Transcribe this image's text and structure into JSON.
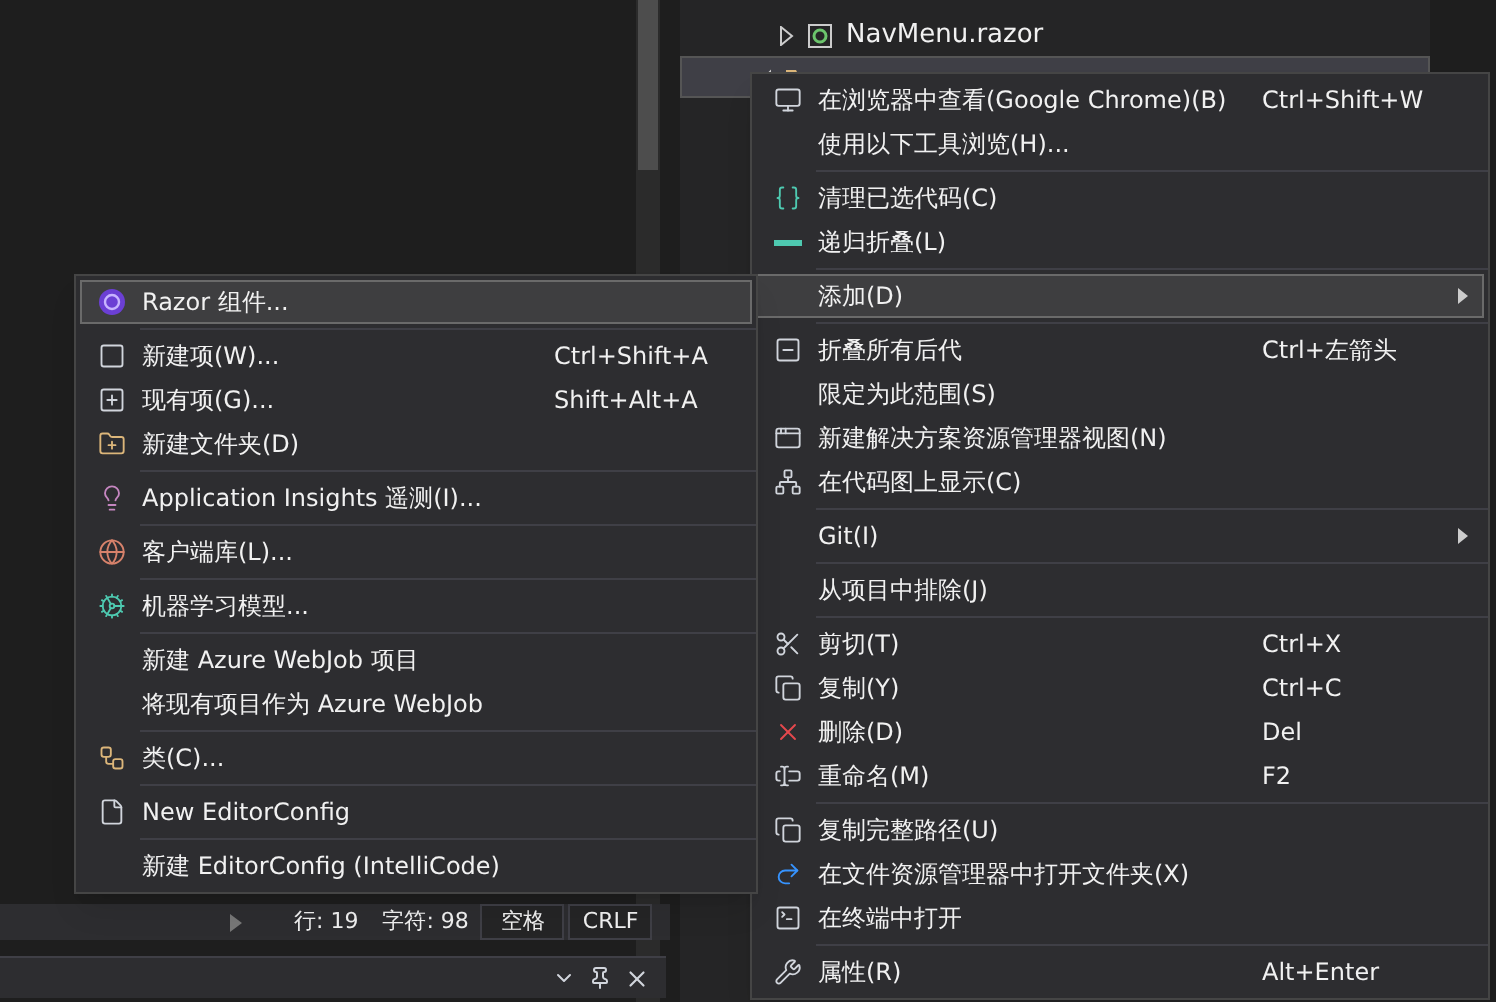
{
  "solution_explorer": {
    "rows": [
      {
        "label": "NavMenu.razor",
        "selected": false
      },
      {
        "selected": true
      }
    ]
  },
  "context_menu": {
    "groups": [
      [
        {
          "label": "在浏览器中查看(Google Chrome)(B)",
          "shortcut": "Ctrl+Shift+W",
          "selected": false,
          "submenu": false
        },
        {
          "label": "使用以下工具浏览(H)...",
          "selected": false,
          "submenu": false
        }
      ],
      [
        {
          "label": "清理已选代码(C)",
          "selected": false,
          "submenu": false
        },
        {
          "label": "递归折叠(L)",
          "selected": false,
          "submenu": false
        }
      ],
      [
        {
          "label": "添加(D)",
          "selected": true,
          "submenu": true
        }
      ],
      [
        {
          "label": "折叠所有后代",
          "shortcut": "Ctrl+左箭头",
          "selected": false,
          "submenu": false
        },
        {
          "label": "限定为此范围(S)",
          "selected": false,
          "submenu": false
        },
        {
          "label": "新建解决方案资源管理器视图(N)",
          "selected": false,
          "submenu": false
        },
        {
          "label": "在代码图上显示(C)",
          "selected": false,
          "submenu": false
        }
      ],
      [
        {
          "label": "Git(I)",
          "selected": false,
          "submenu": true
        }
      ],
      [
        {
          "label": "从项目中排除(J)",
          "selected": false,
          "submenu": false
        }
      ],
      [
        {
          "label": "剪切(T)",
          "shortcut": "Ctrl+X",
          "selected": false,
          "submenu": false
        },
        {
          "label": "复制(Y)",
          "shortcut": "Ctrl+C",
          "selected": false,
          "submenu": false
        },
        {
          "label": "删除(D)",
          "shortcut": "Del",
          "selected": false,
          "submenu": false
        },
        {
          "label": "重命名(M)",
          "shortcut": "F2",
          "selected": false,
          "submenu": false
        }
      ],
      [
        {
          "label": "复制完整路径(U)",
          "selected": false,
          "submenu": false
        },
        {
          "label": "在文件资源管理器中打开文件夹(X)",
          "selected": false,
          "submenu": false
        },
        {
          "label": "在终端中打开",
          "selected": false,
          "submenu": false
        }
      ],
      [
        {
          "label": "属性(R)",
          "shortcut": "Alt+Enter",
          "selected": false,
          "submenu": false
        }
      ]
    ]
  },
  "add_submenu": {
    "groups": [
      [
        {
          "label": "Razor 组件...",
          "selected": true
        }
      ],
      [
        {
          "label": "新建项(W)...",
          "shortcut": "Ctrl+Shift+A",
          "selected": false
        },
        {
          "label": "现有项(G)...",
          "shortcut": "Shift+Alt+A",
          "selected": false
        },
        {
          "label": "新建文件夹(D)",
          "selected": false
        }
      ],
      [
        {
          "label": "Application Insights 遥测(I)...",
          "selected": false
        }
      ],
      [
        {
          "label": "客户端库(L)...",
          "selected": false
        }
      ],
      [
        {
          "label": "机器学习模型...",
          "selected": false
        }
      ],
      [
        {
          "label": "新建 Azure WebJob 项目",
          "selected": false
        },
        {
          "label": "将现有项目作为 Azure WebJob",
          "selected": false
        }
      ],
      [
        {
          "label": "类(C)...",
          "selected": false
        }
      ],
      [
        {
          "label": "New EditorConfig",
          "selected": false
        }
      ],
      [
        {
          "label": "新建 EditorConfig (IntelliCode)",
          "selected": false
        }
      ]
    ]
  },
  "status_bar": {
    "line": "行: 19",
    "char": "字符: 98",
    "whitespace": "空格",
    "line_ending": "CRLF"
  }
}
